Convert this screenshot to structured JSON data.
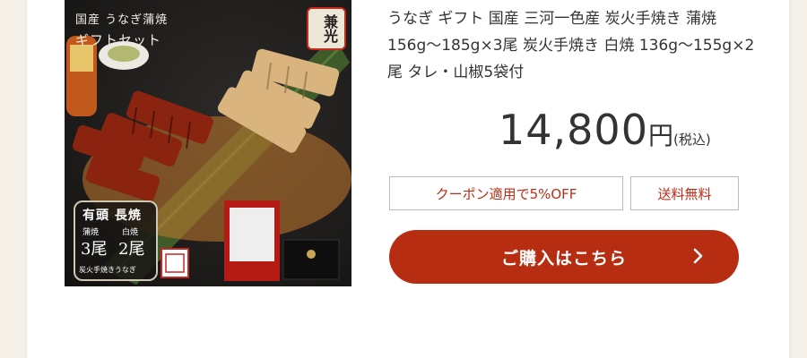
{
  "product": {
    "image": {
      "overlay_line1": "国産 うなぎ蒲焼",
      "overlay_line2": "ギフトセット",
      "seal_text": "兼光",
      "badge_title": "有頭 長焼",
      "badge_label_a": "蒲焼",
      "badge_label_b": "白焼",
      "badge_count_a": "3尾",
      "badge_count_b": "2尾",
      "badge_footer": "炭火手焼きうなぎ"
    },
    "title": "うなぎ ギフト 国産 三河一色産 炭火手焼き 蒲焼 156g〜185g×3尾 炭火手焼き 白焼 136g〜155g×2尾 タレ・山椒5袋付",
    "price": "14,800",
    "price_unit": "円",
    "tax_note": "(税込)",
    "coupon_label": "クーポン適用で5%OFF",
    "shipping_label": "送料無料",
    "buy_label": "ご購入はこちら"
  },
  "colors": {
    "accent": "#b72d12",
    "background": "#f5f1e8"
  },
  "icons": {
    "buy_arrow": "chevron-right-icon"
  }
}
